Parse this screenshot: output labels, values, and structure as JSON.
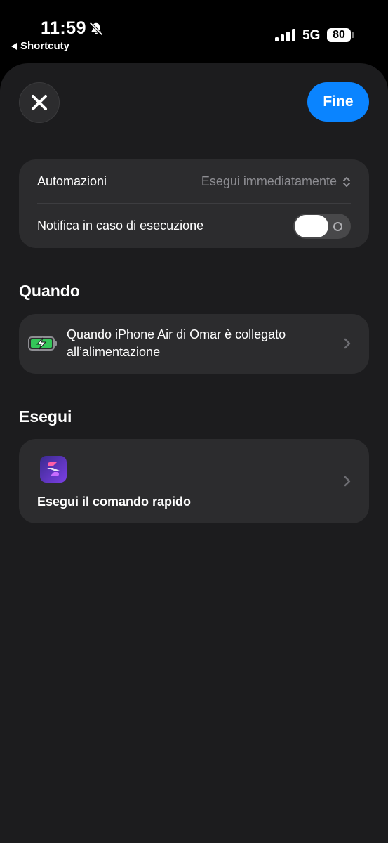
{
  "status": {
    "time": "11:59",
    "back_app": "Shortcuty",
    "network": "5G",
    "battery": "80"
  },
  "header": {
    "done_label": "Fine"
  },
  "settings": {
    "automation_label": "Automazioni",
    "automation_value": "Esegui immediatamente",
    "notify_label": "Notifica in caso di esecuzione",
    "notify_enabled": false
  },
  "when": {
    "title": "Quando",
    "trigger_text": "Quando iPhone Air di Omar è collegato all’alimentazione"
  },
  "run": {
    "title": "Esegui",
    "action_label": "Esegui il comando rapido"
  },
  "colors": {
    "accent": "#0a84ff",
    "sheet": "#1c1c1e",
    "card": "#2c2c2e",
    "battery_green": "#34c759"
  }
}
